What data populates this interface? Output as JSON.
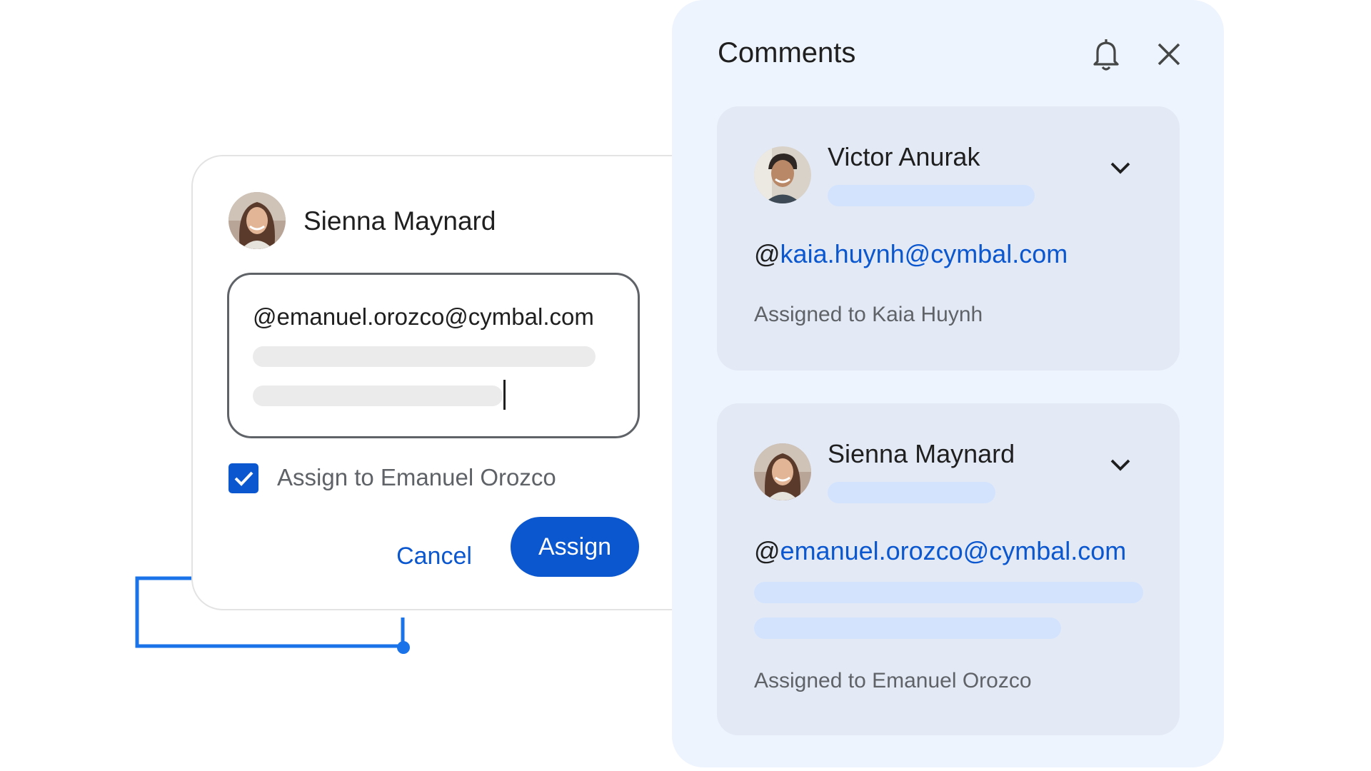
{
  "compose": {
    "author": "Sienna Maynard",
    "mention_text": "@emanuel.orozco@cymbal.com",
    "assign_checkbox_label": "Assign to Emanuel Orozco",
    "assign_checked": true,
    "cancel_label": "Cancel",
    "assign_label": "Assign"
  },
  "panel": {
    "title": "Comments",
    "icons": [
      "bell-icon",
      "close-icon"
    ],
    "comments": [
      {
        "author": "Victor Anurak",
        "mention_prefix": "@",
        "mention": "kaia.huynh@cymbal.com",
        "assigned": "Assigned to Kaia Huynh"
      },
      {
        "author": "Sienna Maynard",
        "mention_prefix": "@",
        "mention": "emanuel.orozco@cymbal.com",
        "assigned": "Assigned to Emanuel Orozco"
      }
    ]
  },
  "colors": {
    "accent": "#0b57d0",
    "panel_bg": "#eef4fd",
    "card_bg": "#e3eaf6",
    "placeholder_blue": "#d3e3fd",
    "placeholder_gray": "#ebebeb"
  }
}
